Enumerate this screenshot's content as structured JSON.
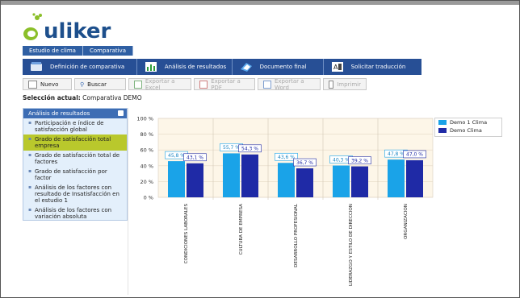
{
  "logo_text": "uliker",
  "nav_tabs": [
    {
      "label": "Estudio de clima"
    },
    {
      "label": "Comparativa"
    }
  ],
  "nav_sections": [
    {
      "label": "Definición de comparativa",
      "icon": "book-icon"
    },
    {
      "label": "Análisis de resultados",
      "icon": "chart-icon"
    },
    {
      "label": "Documento final",
      "icon": "document-icon"
    },
    {
      "label": "Solicitar traducción",
      "icon": "translate-icon"
    }
  ],
  "toolbar": {
    "nuevo": "Nuevo",
    "buscar": "Buscar",
    "excel": "Exportar a Excel",
    "pdf": "Exportar a PDF",
    "word": "Exportar a Word",
    "imprimir": "Imprimir"
  },
  "selection": {
    "label": "Selección actual:",
    "value": "Comparativa DEMO"
  },
  "sidebar": {
    "title": "Análisis de resultados",
    "items": [
      {
        "label": "Participación e índice de satisfacción global"
      },
      {
        "label": "Grado de satisfacción total empresa"
      },
      {
        "label": "Grado de satisfacción total de factores"
      },
      {
        "label": "Grado de satisfacción por factor"
      },
      {
        "label": "Análisis de los factores con resultado de Insatisfacción en el estudio 1"
      },
      {
        "label": "Análisis de los factores con variación absoluta"
      }
    ]
  },
  "colors": {
    "series1": "#1aa3e8",
    "series2": "#1f2aa6",
    "accent": "#274f95"
  },
  "chart_data": {
    "type": "bar",
    "categories": [
      "CONDICIONES LABORALES",
      "CULTURA DE EMPRESA",
      "DESARROLLO PROFESIONAL",
      "LIDERAZGO Y ESTILO DE DIRECCION",
      "ORGANIZACION"
    ],
    "series": [
      {
        "name": "Demo 1 Clima",
        "values": [
          45.8,
          55.7,
          43.6,
          40.3,
          47.8
        ],
        "labels": [
          "45,8 %",
          "55,7 %",
          "43,6 %",
          "40,3 %",
          "47,8 %"
        ]
      },
      {
        "name": "Demo Clima",
        "values": [
          43.1,
          54.3,
          36.7,
          39.2,
          47.0
        ],
        "labels": [
          "43,1 %",
          "54,3 %",
          "36,7 %",
          "39,2 %",
          "47,0 %"
        ]
      }
    ],
    "yticks": [
      "0 %",
      "20 %",
      "40 %",
      "60 %",
      "80 %",
      "100 %"
    ],
    "ylim": [
      0,
      100
    ],
    "grid": true,
    "legend": "top-right"
  }
}
